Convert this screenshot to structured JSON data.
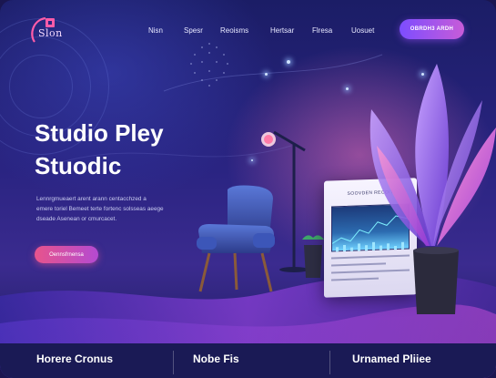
{
  "brand": {
    "logo_text": "Slon"
  },
  "nav": {
    "items": [
      {
        "label": "Nisn"
      },
      {
        "label": "Spesr"
      },
      {
        "label": "Reoisms"
      },
      {
        "label": "Hertsar"
      },
      {
        "label": "Flresa"
      },
      {
        "label": "Uosuet"
      }
    ],
    "cta_label": "OBRDH3 ARDH"
  },
  "hero": {
    "title_line1": "Studio Pley",
    "title_line2": "Stuodic",
    "body_lines": [
      "Lennrgmueaert arent arann centacchzed a",
      "emere toriel Bemeet terte fortenc solsseas aeege",
      "dseade Asenean or cmurcacet."
    ],
    "button_label": "Oennsfrnensa"
  },
  "illustration": {
    "screen_title": "SOOVDEN RECOIT"
  },
  "footer": {
    "items": [
      {
        "label": "Horere Cronus"
      },
      {
        "label": "Nobe Fis"
      },
      {
        "label": "Urnamed Pliiee"
      }
    ]
  },
  "colors": {
    "cta_top": "#7c4dff",
    "hero_button": "#e7548c",
    "background": "#1b1d66"
  },
  "icons": [
    "logo-icon",
    "microphone-stand-icon",
    "armchair-icon",
    "plant-icon",
    "plant-pot-icon",
    "screen-display-icon"
  ]
}
